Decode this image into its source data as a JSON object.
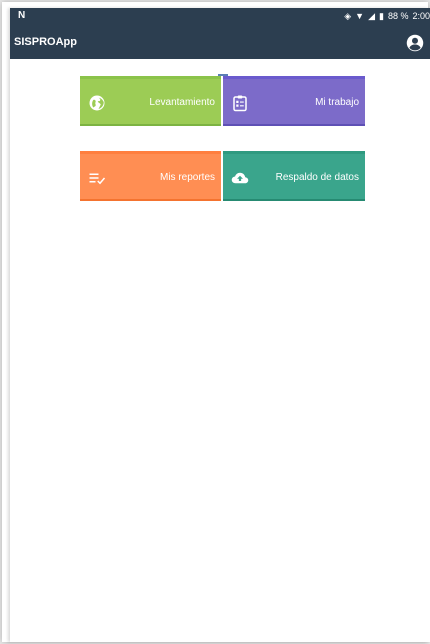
{
  "status_bar": {
    "left_icon": "N",
    "battery": "88 %",
    "time": "2:00",
    "icons": [
      "vibrate-icon",
      "wifi-icon",
      "signal-icon",
      "battery-icon"
    ]
  },
  "app_bar": {
    "title": "SISPROApp",
    "account_icon": "account-circle-icon"
  },
  "tiles": [
    {
      "label": "Levantamiento",
      "icon": "globe-icon",
      "color": "#9ccc55"
    },
    {
      "label": "Mi trabajo",
      "icon": "clipboard-icon",
      "color": "#7c6bc9"
    },
    {
      "label": "Mis reportes",
      "icon": "list-check-icon",
      "color": "#ff8e53"
    },
    {
      "label": "Respaldo de datos",
      "icon": "cloud-upload-icon",
      "color": "#3aa58c"
    }
  ],
  "colors": {
    "app_bar": "#2c3e50",
    "background": "#ffffff"
  }
}
